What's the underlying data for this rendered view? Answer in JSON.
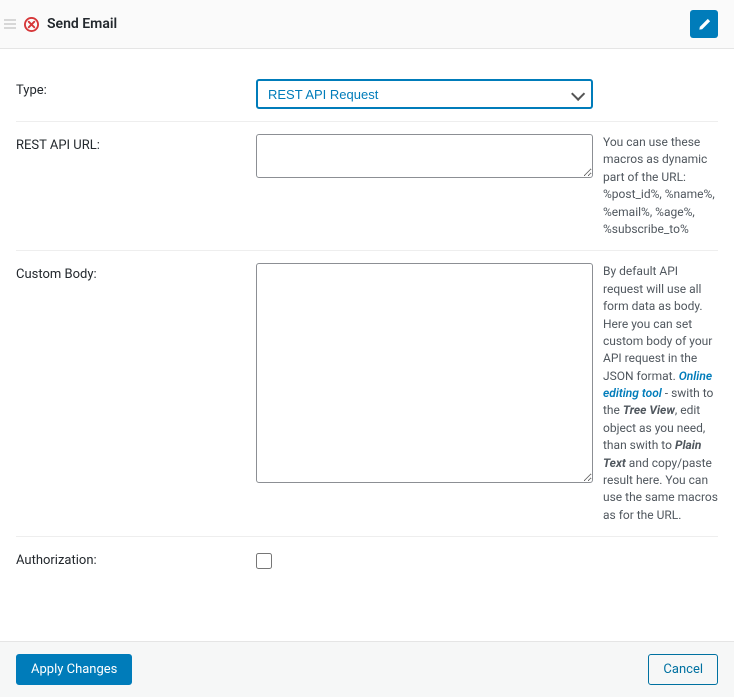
{
  "header": {
    "title": "Send Email"
  },
  "form": {
    "type_label": "Type:",
    "type_value": "REST API Request",
    "url_label": "REST API URL:",
    "url_value": "",
    "url_help": "You can use these macros as dynamic part of the URL: %post_id%, %name%, %email%, %age%, %subscribe_to%",
    "body_label": "Custom Body:",
    "body_value": "",
    "body_help_1": "By default API request will use all form data as body. Here you can set custom body of your API request in the JSON format. ",
    "body_help_link": "Online editing tool",
    "body_help_2": " - swith to the ",
    "body_help_b1": "Tree View",
    "body_help_3": ", edit object as you need, than swith to ",
    "body_help_b2": "Plain Text",
    "body_help_4": " and copy/paste result here. You can use the same macros as for the URL.",
    "auth_label": "Authorization:"
  },
  "footer": {
    "apply": "Apply Changes",
    "cancel": "Cancel"
  }
}
